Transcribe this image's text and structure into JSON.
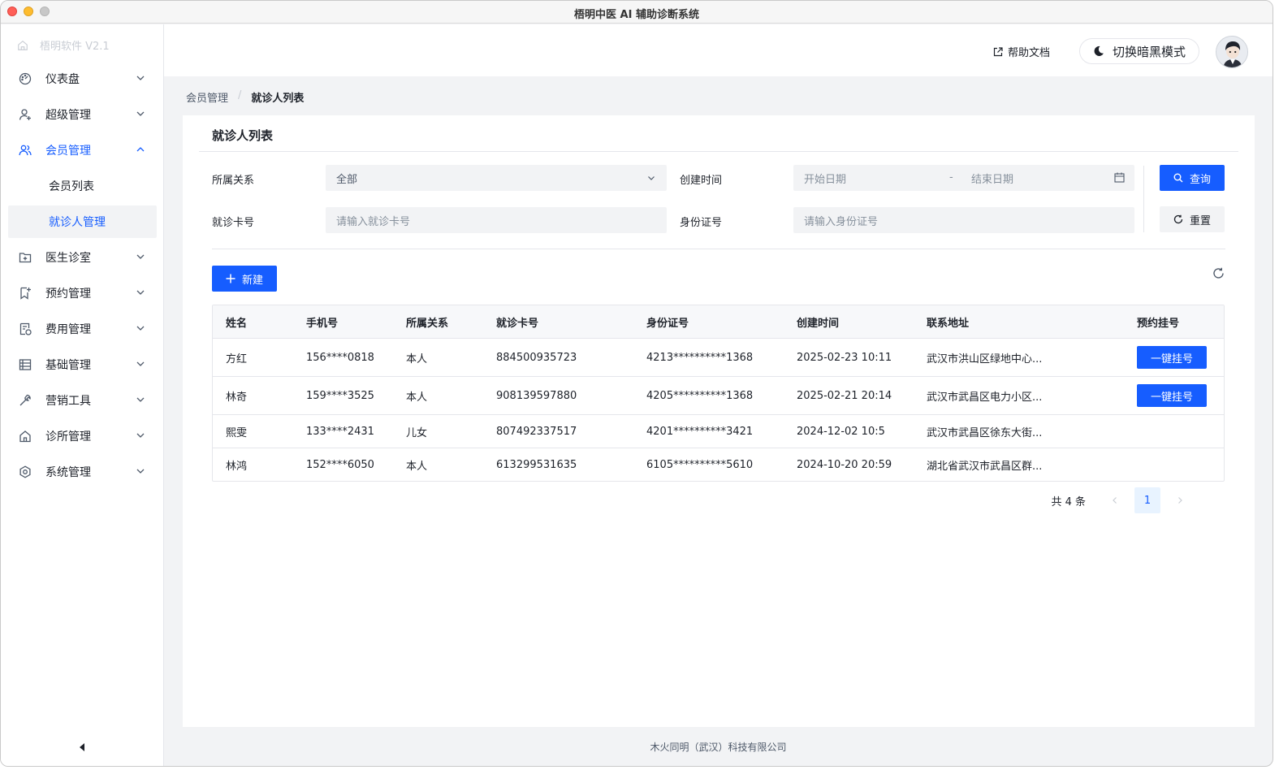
{
  "window": {
    "title": "梧明中医 AI 辅助诊断系统"
  },
  "sidebar": {
    "brand": "梧明软件 V2.1",
    "menu": [
      {
        "label": "仪表盘",
        "icon": "dashboard-icon"
      },
      {
        "label": "超级管理",
        "icon": "user-add-icon"
      },
      {
        "label": "会员管理",
        "icon": "user-group-icon",
        "open": true
      },
      {
        "label": "医生诊室",
        "icon": "folder-add-icon"
      },
      {
        "label": "预约管理",
        "icon": "bookmark-icon"
      },
      {
        "label": "费用管理",
        "icon": "file-money-icon"
      },
      {
        "label": "基础管理",
        "icon": "list-icon"
      },
      {
        "label": "营销工具",
        "icon": "tool-icon"
      },
      {
        "label": "诊所管理",
        "icon": "home-icon"
      },
      {
        "label": "系统管理",
        "icon": "settings-icon"
      }
    ],
    "submenu": [
      {
        "label": "会员列表"
      },
      {
        "label": "就诊人管理",
        "active": true
      }
    ]
  },
  "topbar": {
    "help_label": "帮助文档",
    "dark_mode_label": "切换暗黑模式"
  },
  "breadcrumb": {
    "parent": "会员管理",
    "current": "就诊人列表"
  },
  "panel": {
    "title": "就诊人列表"
  },
  "filters": {
    "relation_label": "所属关系",
    "relation_value": "全部",
    "created_label": "创建时间",
    "start_placeholder": "开始日期",
    "date_sep": "-",
    "end_placeholder": "结束日期",
    "card_label": "就诊卡号",
    "card_placeholder": "请输入就诊卡号",
    "id_label": "身份证号",
    "id_placeholder": "请输入身份证号",
    "query_label": "查询",
    "reset_label": "重置"
  },
  "toolbar": {
    "new_label": "新建"
  },
  "table": {
    "columns": [
      "姓名",
      "手机号",
      "所属关系",
      "就诊卡号",
      "身份证号",
      "创建时间",
      "联系地址",
      "预约挂号"
    ],
    "rows": [
      {
        "name": "方红",
        "phone": "156****0818",
        "relation": "本人",
        "card": "884500935723",
        "id": "4213**********1368",
        "created": "2025-02-23 10:11",
        "address": "武汉市洪山区绿地中心...",
        "action": "一键挂号"
      },
      {
        "name": "林奇",
        "phone": "159****3525",
        "relation": "本人",
        "card": "908139597880",
        "id": "4205**********1368",
        "created": "2025-02-21 20:14",
        "address": "武汉市武昌区电力小区...",
        "action": "一键挂号"
      },
      {
        "name": "熙雯",
        "phone": "133****2431",
        "relation": "儿女",
        "card": "807492337517",
        "id": "4201**********3421",
        "created": "2024-12-02 10:5",
        "address": "武汉市武昌区徐东大街...",
        "action": ""
      },
      {
        "name": "林鸿",
        "phone": "152****6050",
        "relation": "本人",
        "card": "613299531635",
        "id": "6105**********5610",
        "created": "2024-10-20 20:59",
        "address": "湖北省武汉市武昌区群...",
        "action": ""
      }
    ]
  },
  "pagination": {
    "total": "共 4 条",
    "current_page": "1"
  },
  "footer": {
    "text": "木火同明（武汉）科技有限公司"
  }
}
